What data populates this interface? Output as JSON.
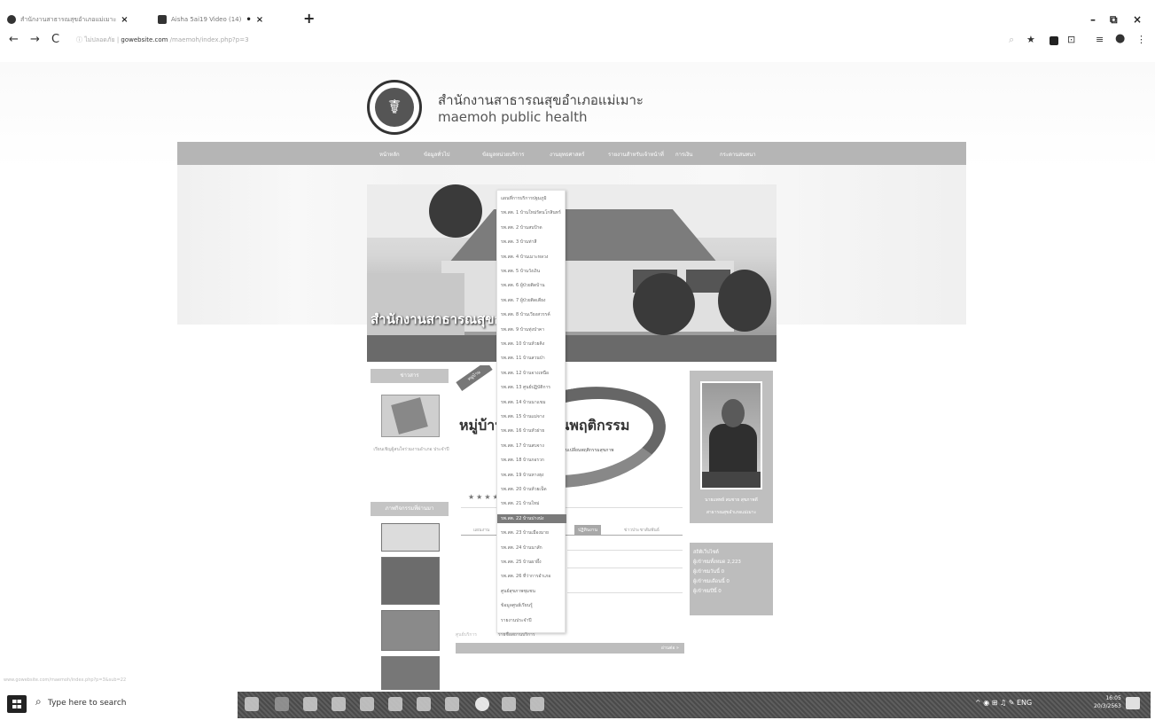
{
  "browser": {
    "tabs": [
      {
        "title": "สำนักงานสาธารณสุขอำเภอแม่เมาะ"
      },
      {
        "title": "Aisha 5ai19 Video (14)"
      }
    ],
    "new_tab": "+",
    "nav": {
      "back": "←",
      "forward": "→",
      "reload": "C"
    },
    "address": {
      "prefix": "ไม่ปลอดภัย",
      "domain": "gowebsite.com",
      "path": "/maemoh/index.php?p=3"
    },
    "window_controls": {
      "minimize": "–",
      "restore": "⧉",
      "close": "×"
    }
  },
  "site": {
    "title": "สำนักงานสาธารณสุขอำเภอแม่เมาะ",
    "subtitle": "maemoh public health",
    "menu": [
      "หน้าหลัก",
      "ข้อมูลทั่วไป",
      "ข้อมูลหน่วยบริการ",
      "งานยุทธศาสตร์",
      "รายงานสำหรับเจ้าหน้าที่",
      "การเงิน",
      "กระดานสนทนา"
    ],
    "banner_caption": "สำนักงานสาธารณสุขอำเภอ",
    "left_sidebar": {
      "news_heading": "ข่าวสาร",
      "news_caption": "เรียนเชิญผู้สนใจร่วมงานอำเภอ ประจำปี",
      "gallery_heading": "ภาพกิจกรรมที่ผ่านมา"
    },
    "campaign": {
      "ribbon": "หมู่บ้าน",
      "headline": "หมู่บ้าน       ขับเคลื่อนพฤติกรรม",
      "tagline": "ปรับเปลี่ยนพฤติกรรมสุขภาพ",
      "stars": "★★★★"
    },
    "content_tabs": [
      "แผนงาน",
      "ปฏิทินงาน",
      "ข่าวประชาสัมพันธ์"
    ],
    "news_bar_more": "อ่านต่อ »",
    "chief": {
      "name": "นายแพทย์ สมชาย สุขภาพดี",
      "title": "สาธารณสุขอำเภอแม่เมาะ"
    },
    "stats": {
      "heading": "สถิติเว็บไซต์",
      "rows": [
        "ผู้เข้าชมทั้งหมด 2,223",
        "ผู้เข้าชมวันนี้ 0",
        "ผู้เข้าชมเดือนนี้ 0",
        "ผู้เข้าชมปีนี้ 0"
      ]
    }
  },
  "dropdown": {
    "items": [
      "แผนที่การบริการปฐมภูมิ",
      "รพ.สต. 1 บ้านใหม่รัตนโกสินทร์",
      "รพ.สต. 2 บ้านสบป้าด",
      "รพ.สต. 3 บ้านท่าสี",
      "รพ.สต. 4 บ้านเมาะหลวง",
      "รพ.สต. 5 บ้านวังเงิน",
      "รพ.สต. 6 ผู้ป่วยติดบ้าน",
      "รพ.สต. 7 ผู้ป่วยติดเตียง",
      "รพ.สต. 8 บ้านเวียงสวรรค์",
      "รพ.สต. 9 บ้านทุ่งป่าคา",
      "รพ.สต. 10 บ้านห้วยคิง",
      "รพ.สต. 11 บ้านสวนป่า",
      "รพ.สต. 12 บ้านจางเหนือ",
      "รพ.สต. 13 ศูนย์ปฏิบัติการ",
      "รพ.สต. 14 บ้านนาแขม",
      "รพ.สต. 15 บ้านแม่จาง",
      "รพ.สต. 16 บ้านหัวฝาย",
      "รพ.สต. 17 บ้านสบจาง",
      "รพ.สต. 18 บ้านกอรวก",
      "รพ.สต. 19 บ้านหางฮุง",
      "รพ.สต. 20 บ้านห้วยเป็ด",
      "รพ.สต. 21 บ้านใหม่",
      "รพ.สต. 22 บ้านปางปง",
      "รพ.สต. 23 บ้านเมืองมาย",
      "รพ.สต. 24 บ้านนาสัก",
      "รพ.สต. 25 บ้านผาผึ้ง",
      "รพ.สต. 26 ที่ว่าการอำเภอ",
      "ศูนย์สุขภาพชุมชน",
      "ข้อมูลศูนย์เรียนรู้",
      "รายงานประจำปี"
    ],
    "selected_index": 22
  },
  "below_dropdown": {
    "label": "ศูนย์บริการ",
    "text": "รายชื่อสถานบริการ"
  },
  "status_url": "www.gowebsite.com/maemoh/index.php?p=3&sub=22",
  "taskbar": {
    "search_placeholder": "Type here to search",
    "tray": "^ ◉ ⊞ ♫ ✎ ENG",
    "time": "16:05",
    "date": "20/3/2563"
  }
}
